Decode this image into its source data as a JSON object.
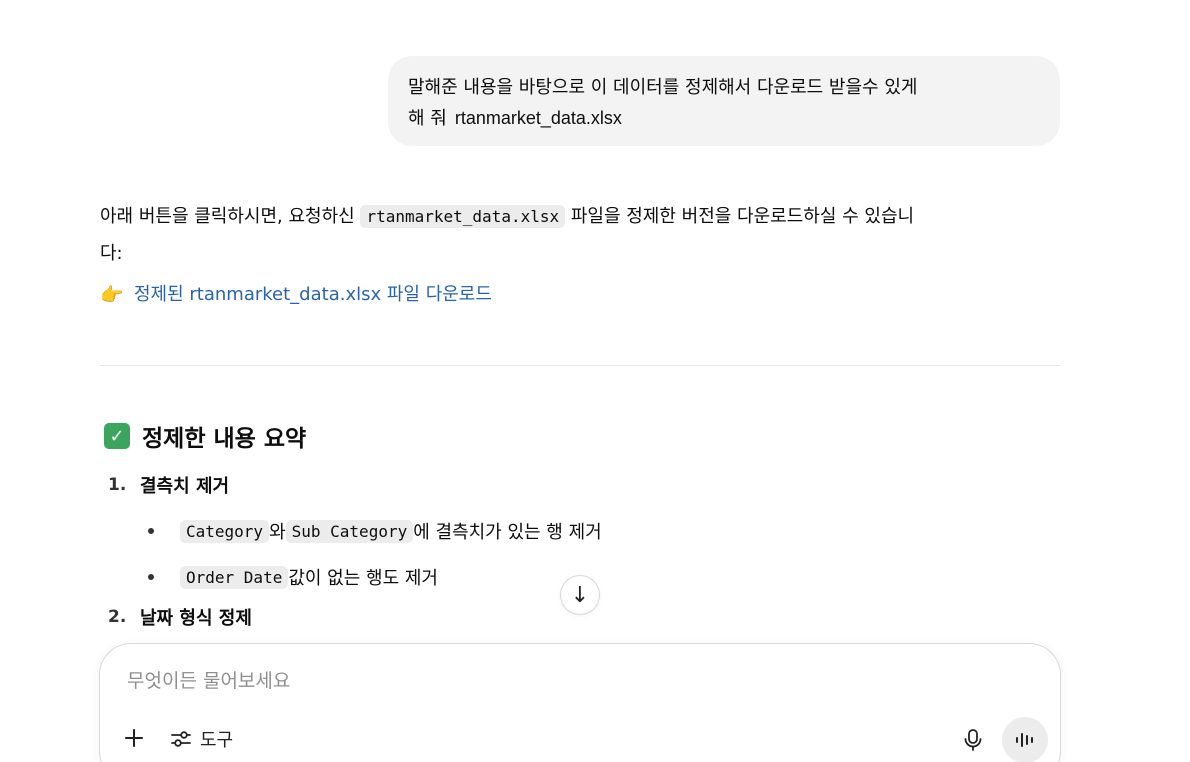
{
  "user_message": {
    "line1": "말해준 내용을 바탕으로 이 데이터를 정제해서 다운로드 받을수 있게",
    "line2_text": "해 줘",
    "file": "rtanmarket_data.xlsx"
  },
  "assistant": {
    "intro_before": "아래 버튼을 클릭하시면, 요청하신 ",
    "intro_code": "rtanmarket_data.xlsx",
    "intro_after": " 파일을 정제한 버전을 다운로드하실 수 있습니",
    "intro_wrap": "다:",
    "link_emoji": "👉",
    "link_label": "정제된 rtanmarket_data.xlsx 파일 다운로드"
  },
  "summary": {
    "check_icon": "✓",
    "title": "정제한 내용 요약",
    "items": [
      {
        "num": "1.",
        "label": "결측치 제거",
        "bullets": [
          {
            "code1": "Category",
            "mid": "와 ",
            "code2": "Sub Category",
            "text": "에 결측치가 있는 행 제거"
          },
          {
            "code1": "Order Date",
            "text": " 값이 없는 행도 제거"
          }
        ]
      },
      {
        "num": "2.",
        "label": "날짜 형식 정제"
      }
    ]
  },
  "composer": {
    "placeholder": "무엇이든 물어보세요",
    "tools_label": "도구",
    "icons": [
      "plus-icon",
      "sliders-icon",
      "mic-icon",
      "voice-mode-icon"
    ]
  },
  "scroll_down_icon": "↓"
}
